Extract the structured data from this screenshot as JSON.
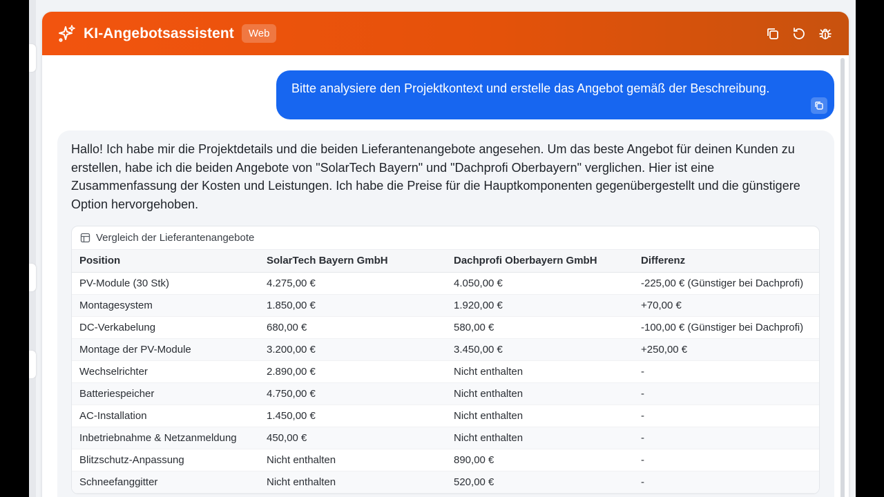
{
  "header": {
    "title": "KI-Angebotsassistent",
    "badge": "Web",
    "icons": [
      "sparkles-icon",
      "copy-icon",
      "refresh-icon",
      "bug-icon"
    ]
  },
  "user_message": {
    "text": "Bitte analysiere den Projektkontext und erstelle das Angebot gemäß der Beschreibung."
  },
  "assistant_message": {
    "paragraph": "Hallo! Ich habe mir die Projektdetails und die beiden Lieferantenangebote angesehen. Um das beste Angebot für deinen Kunden zu erstellen, habe ich die beiden Angebote von \"SolarTech Bayern\" und \"Dachprofi Oberbayern\" verglichen. Hier ist eine Zusammenfassung der Kosten und Leistungen. Ich habe die Preise für die Hauptkomponenten gegenübergestellt und die günstigere Option hervorgehoben.",
    "table": {
      "caption": "Vergleich der Lieferantenangebote",
      "headers": [
        "Position",
        "SolarTech Bayern GmbH",
        "Dachprofi Oberbayern GmbH",
        "Differenz"
      ],
      "rows": [
        [
          "PV-Module (30 Stk)",
          "4.275,00 €",
          "4.050,00 €",
          "-225,00 € (Günstiger bei Dachprofi)"
        ],
        [
          "Montagesystem",
          "1.850,00 €",
          "1.920,00 €",
          "+70,00 €"
        ],
        [
          "DC-Verkabelung",
          "680,00 €",
          "580,00 €",
          "-100,00 € (Günstiger bei Dachprofi)"
        ],
        [
          "Montage der PV-Module",
          "3.200,00 €",
          "3.450,00 €",
          "+250,00 €"
        ],
        [
          "Wechselrichter",
          "2.890,00 €",
          "Nicht enthalten",
          "-"
        ],
        [
          "Batteriespeicher",
          "4.750,00 €",
          "Nicht enthalten",
          "-"
        ],
        [
          "AC-Installation",
          "1.450,00 €",
          "Nicht enthalten",
          "-"
        ],
        [
          "Inbetriebnahme & Netzanmeldung",
          "450,00 €",
          "Nicht enthalten",
          "-"
        ],
        [
          "Blitzschutz-Anpassung",
          "Nicht enthalten",
          "890,00 €",
          "-"
        ],
        [
          "Schneefanggitter",
          "Nicht enthalten",
          "520,00 €",
          "-"
        ]
      ]
    }
  },
  "colors": {
    "header_start": "#f2540f",
    "header_end": "#c8520e",
    "user_bubble": "#1766f0",
    "assistant_bubble": "#f3f5f8"
  }
}
